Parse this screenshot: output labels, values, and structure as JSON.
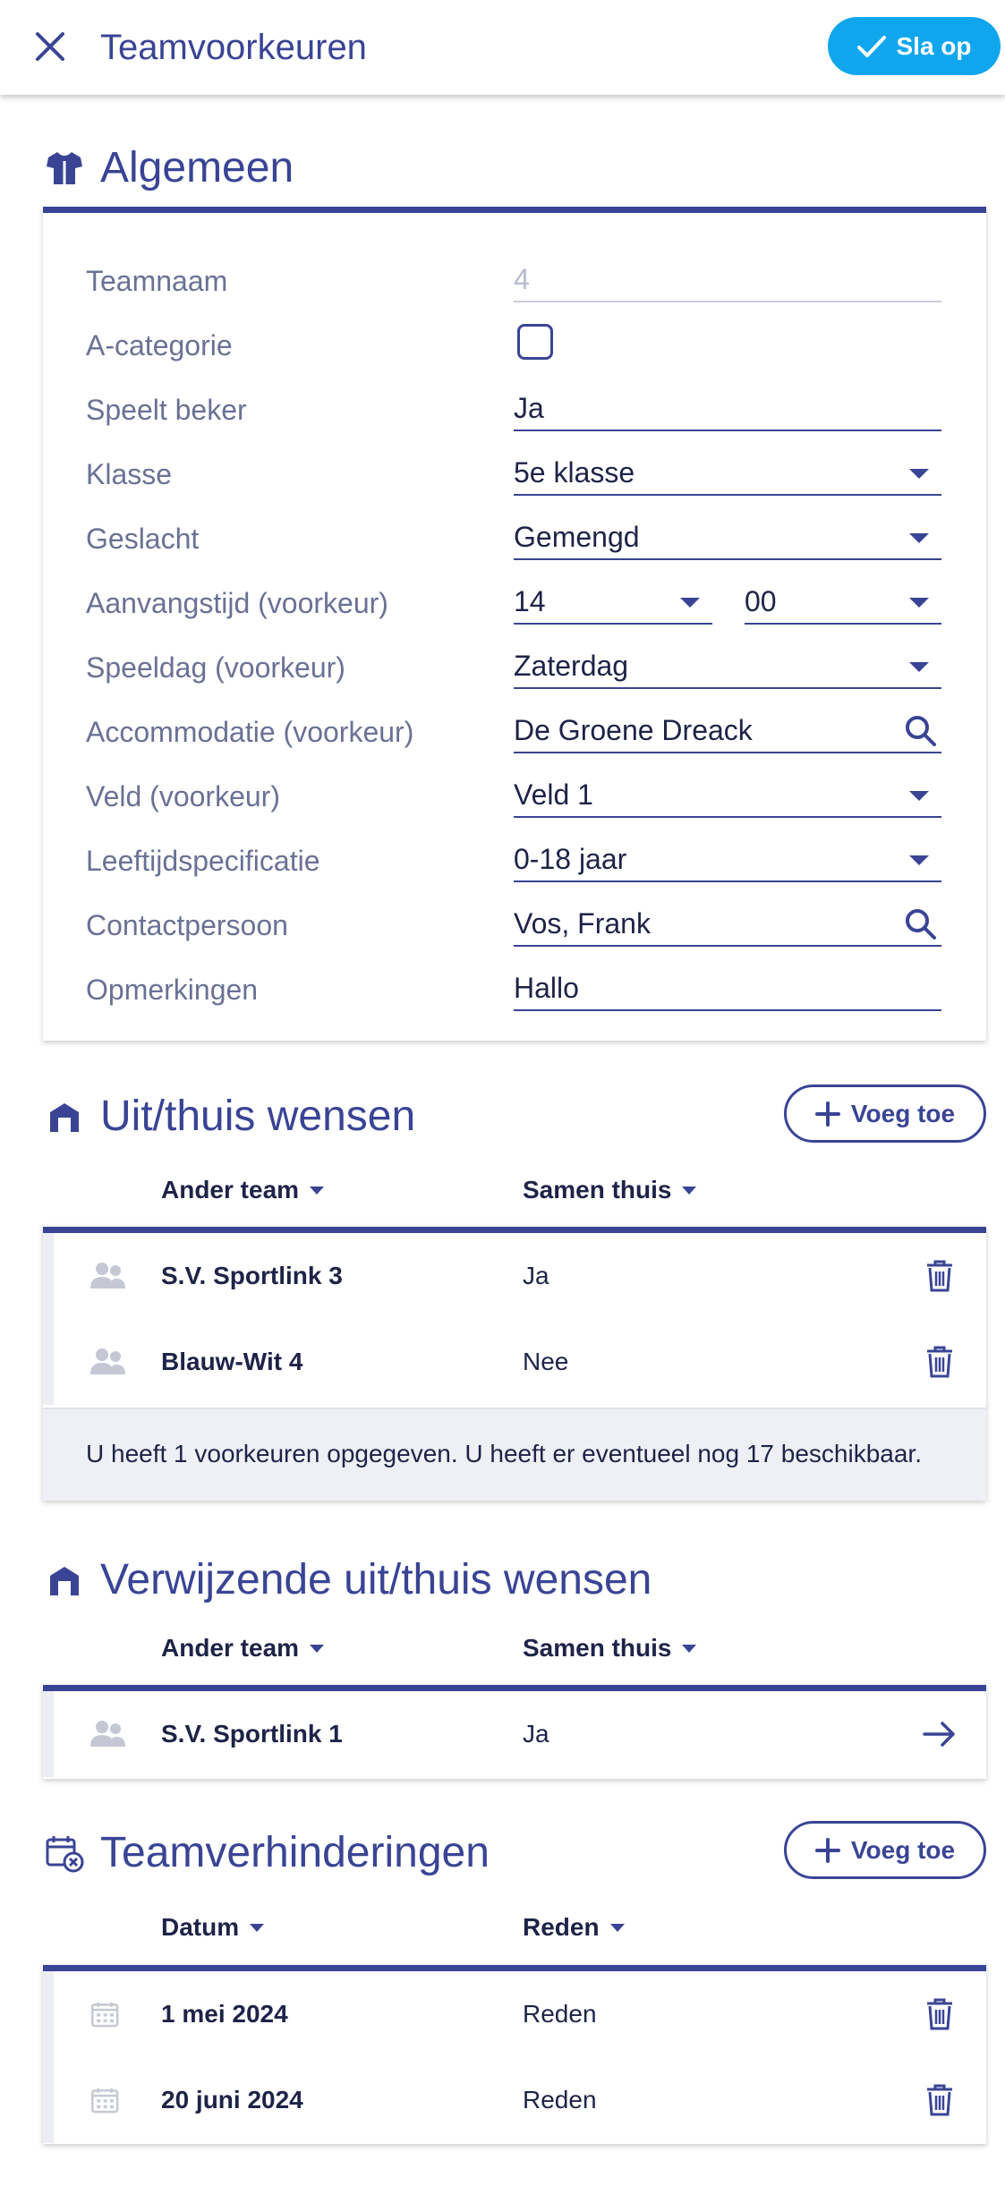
{
  "header": {
    "title": "Teamvoorkeuren",
    "save_label": "Sla op"
  },
  "colors": {
    "accent": "#3a4495",
    "save": "#10a6ee"
  },
  "general": {
    "title": "Algemeen",
    "icon": "shirt-icon",
    "fields": {
      "teamnaam": {
        "label": "Teamnaam",
        "value": "4"
      },
      "a_categorie": {
        "label": "A-categorie",
        "checked": false
      },
      "speelt_beker": {
        "label": "Speelt beker",
        "value": "Ja"
      },
      "klasse": {
        "label": "Klasse",
        "value": "5e klasse"
      },
      "geslacht": {
        "label": "Geslacht",
        "value": "Gemengd"
      },
      "aanvangstijd": {
        "label": "Aanvangstijd (voorkeur)",
        "hour": "14",
        "minute": "00"
      },
      "speeldag": {
        "label": "Speeldag (voorkeur)",
        "value": "Zaterdag"
      },
      "accommodatie": {
        "label": "Accommodatie (voorkeur)",
        "value": "De Groene Dreack"
      },
      "veld": {
        "label": "Veld (voorkeur)",
        "value": "Veld 1"
      },
      "leeftijd": {
        "label": "Leeftijdspecificatie",
        "value": "0-18 jaar"
      },
      "contact": {
        "label": "Contactpersoon",
        "value": "Vos, Frank"
      },
      "opmerkingen": {
        "label": "Opmerkingen",
        "value": "Hallo"
      }
    }
  },
  "home_away": {
    "title": "Uit/thuis wensen",
    "add_label": "Voeg toe",
    "columns": [
      "Ander team",
      "Samen thuis"
    ],
    "rows": [
      {
        "team": "S.V. Sportlink 3",
        "together": "Ja"
      },
      {
        "team": "Blauw-Wit 4",
        "together": "Nee"
      }
    ],
    "info": "U heeft 1 voorkeuren opgegeven. U heeft er eventueel nog 17 beschikbaar."
  },
  "referring": {
    "title": "Verwijzende uit/thuis wensen",
    "columns": [
      "Ander team",
      "Samen thuis"
    ],
    "rows": [
      {
        "team": "S.V. Sportlink 1",
        "together": "Ja"
      }
    ]
  },
  "blocks": {
    "title": "Teamverhinderingen",
    "add_label": "Voeg toe",
    "columns": [
      "Datum",
      "Reden"
    ],
    "rows": [
      {
        "date": "1 mei 2024",
        "reason": "Reden"
      },
      {
        "date": "20 juni 2024",
        "reason": "Reden"
      }
    ]
  }
}
